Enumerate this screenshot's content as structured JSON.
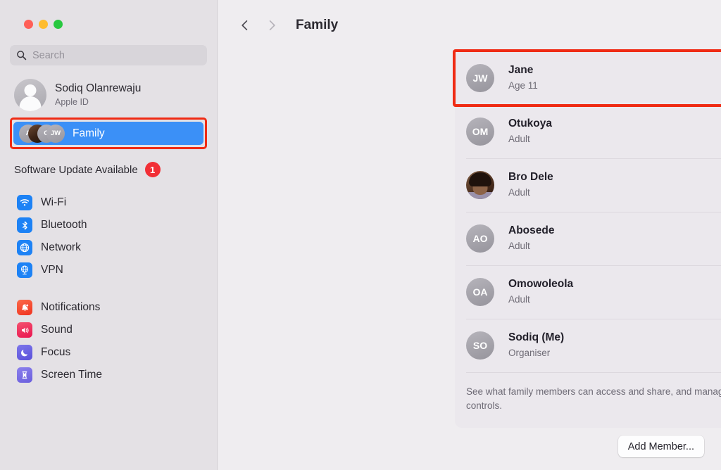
{
  "window": {
    "traffic_lights": [
      "close",
      "minimize",
      "zoom"
    ],
    "colors": {
      "close": "#ff5f57",
      "minimize": "#febc2e",
      "zoom": "#28c840",
      "accent": "#3b90f7",
      "annotation": "#ef2b14",
      "badge": "#f22f36"
    }
  },
  "sidebar": {
    "search": {
      "placeholder": "Search",
      "value": "",
      "icon": "search-icon"
    },
    "account": {
      "name": "Sodiq Olanrewaju",
      "subtitle": "Apple ID",
      "avatar": "person-placeholder-avatar"
    },
    "family": {
      "label": "Family",
      "selected": true,
      "avatars": [
        {
          "initials": "A",
          "type": "initials"
        },
        {
          "initials": "",
          "type": "photo"
        },
        {
          "initials": "O",
          "type": "initials"
        },
        {
          "initials": "JW",
          "type": "initials"
        }
      ]
    },
    "update": {
      "label": "Software Update Available",
      "badge": "1"
    },
    "groups": [
      {
        "items": [
          {
            "label": "Wi-Fi",
            "icon": "wifi-icon",
            "color": "#1d82f5"
          },
          {
            "label": "Bluetooth",
            "icon": "bluetooth-icon",
            "color": "#1d82f5"
          },
          {
            "label": "Network",
            "icon": "globe-icon",
            "color": "#1d82f5"
          },
          {
            "label": "VPN",
            "icon": "vpn-globe-icon",
            "color": "#1d82f5"
          }
        ]
      },
      {
        "items": [
          {
            "label": "Notifications",
            "icon": "bell-icon",
            "color": "#f5462d"
          },
          {
            "label": "Sound",
            "icon": "speaker-icon",
            "color": "#f0336a"
          },
          {
            "label": "Focus",
            "icon": "moon-icon",
            "color": "#6b63e0"
          },
          {
            "label": "Screen Time",
            "icon": "hourglass-icon",
            "color": "#7a6fe3"
          }
        ]
      }
    ]
  },
  "toolbar": {
    "back_icon": "chevron-left-icon",
    "forward_icon": "chevron-right-icon",
    "title": "Family"
  },
  "main": {
    "members": [
      {
        "name": "Jane",
        "role": "Age 11",
        "initials": "JW",
        "avatar_type": "initials",
        "highlighted": true
      },
      {
        "name": "Otukoya",
        "role": "Adult",
        "initials": "OM",
        "avatar_type": "initials",
        "highlighted": false
      },
      {
        "name": "Bro Dele",
        "role": "Adult",
        "initials": "",
        "avatar_type": "photo",
        "highlighted": false
      },
      {
        "name": "Abosede",
        "role": "Adult",
        "initials": "AO",
        "avatar_type": "initials",
        "highlighted": false
      },
      {
        "name": "Omowoleola",
        "role": "Adult",
        "initials": "OA",
        "avatar_type": "initials",
        "highlighted": false
      },
      {
        "name": "Sodiq (Me)",
        "role": "Organiser",
        "initials": "SO",
        "avatar_type": "initials",
        "highlighted": false
      }
    ],
    "footnote": "See what family members can access and share, and manage child account settings and parental controls.",
    "add_member_label": "Add Member..."
  }
}
